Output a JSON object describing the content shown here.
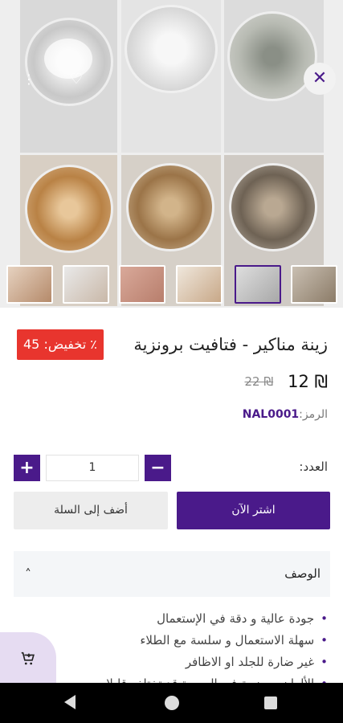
{
  "gallery": {
    "close_icon": "close-icon",
    "favorite_icon": "heart-icon",
    "more_icon": "kebab-icon",
    "image_count": 6,
    "thumbnail_count": 6,
    "active_thumbnail": 5
  },
  "product": {
    "title": "زينة مناكير - فتافيت برونزية",
    "discount_label": "تخفيض: 45 ٪",
    "price_current": "₪ 12",
    "price_old": "₪ 22",
    "sku_label": "الرمز:",
    "sku_value": "NAL0001"
  },
  "quantity": {
    "label": "العدد:",
    "value": "1",
    "plus": "+",
    "minus": "−"
  },
  "actions": {
    "buy_now": "اشتر الآن",
    "add_to_cart": "أضف إلى السلة"
  },
  "description": {
    "title": "الوصف",
    "items": [
      "جودة عالية و دقة في الإستعمال",
      "سهلة الاستعمال و سلسة مع الطلاء",
      "غير ضارة للجلد او الاظافر",
      "الألوان موضحة في الصورة قد تختلف قليلا بسبب"
    ]
  },
  "colors": {
    "accent": "#4a1a8a",
    "discount": "#e8352e"
  }
}
